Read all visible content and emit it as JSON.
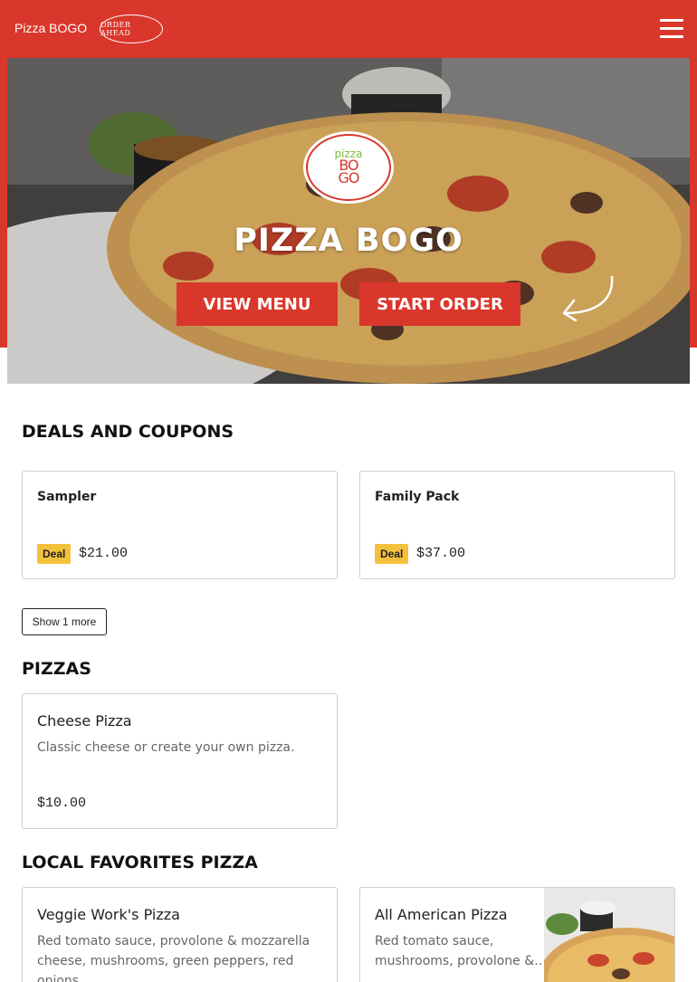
{
  "header": {
    "brand": "Pizza BOGO",
    "order_ahead": "ORDER AHEAD",
    "menu_icon": "hamburger-icon"
  },
  "hero": {
    "logo_line1": "pizza",
    "logo_line2": "BO",
    "logo_line3": "GO",
    "title": "PIZZA BOGO",
    "view_menu": "VIEW MENU",
    "start_order": "START ORDER",
    "arrow_icon": "curved-arrow-icon"
  },
  "deals": {
    "title": "DEALS AND COUPONS",
    "items": [
      {
        "name": "Sampler",
        "badge": "Deal",
        "price": "$21.00"
      },
      {
        "name": "Family Pack",
        "badge": "Deal",
        "price": "$37.00"
      }
    ],
    "show_more": "Show 1 more"
  },
  "pizzas": {
    "title": "PIZZAS",
    "items": [
      {
        "name": "Cheese Pizza",
        "description": "Classic cheese or create your own pizza.",
        "price": "$10.00"
      }
    ]
  },
  "local_favorites": {
    "title": "LOCAL FAVORITES PIZZA",
    "items": [
      {
        "name": "Veggie Work's Pizza",
        "desc_line1": "Red tomato sauce, provolone & mozzarella",
        "desc_line2": "cheese, mushrooms, green peppers, red onions,…"
      },
      {
        "name": "All American Pizza",
        "desc_line1": "Red tomato sauce,",
        "desc_line2": "mushrooms, provolone &…"
      }
    ]
  },
  "colors": {
    "brand_red": "#d9372b",
    "deal_yellow": "#f4c13c"
  }
}
